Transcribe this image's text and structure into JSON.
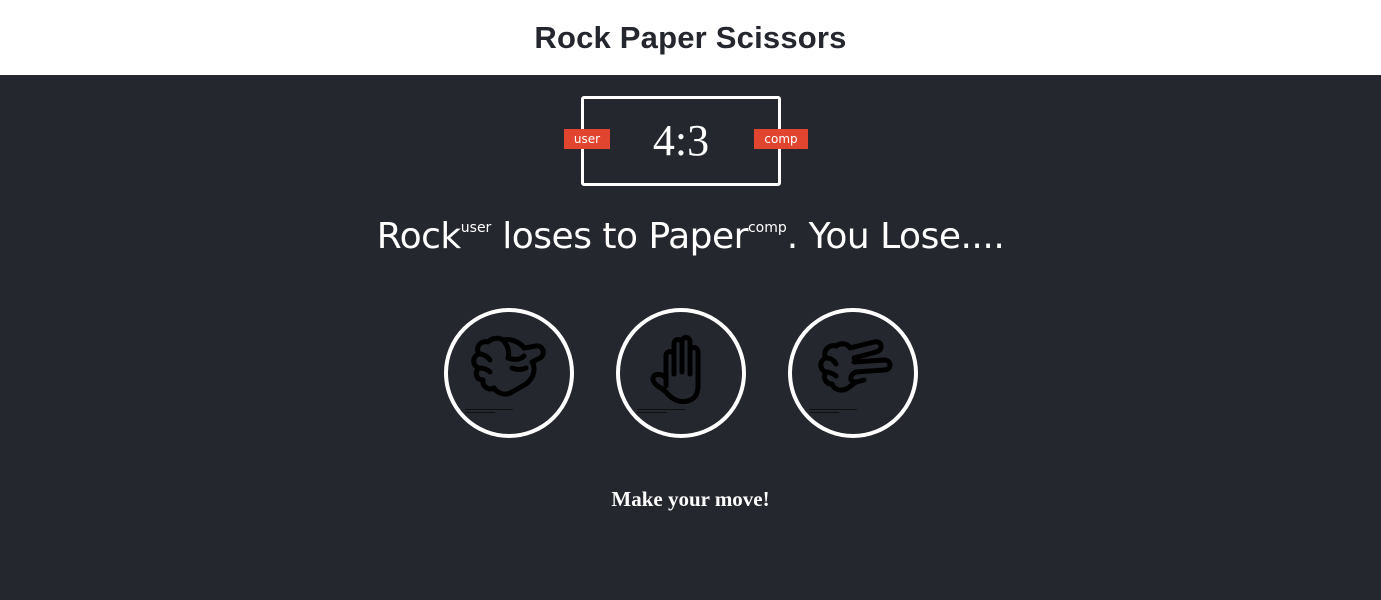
{
  "header": {
    "title": "Rock Paper Scissors"
  },
  "scoreboard": {
    "score": "4:3",
    "user_label": "user",
    "comp_label": "comp"
  },
  "result": {
    "user_choice": "Rock",
    "user_tag": "user",
    "verb": " loses to ",
    "comp_choice": "Paper",
    "comp_tag": "comp",
    "message": ". You Lose...."
  },
  "choices": [
    {
      "icon": "rock-fist-icon"
    },
    {
      "icon": "paper-hand-icon"
    },
    {
      "icon": "scissors-hand-icon"
    }
  ],
  "action_message": "Make your move!",
  "colors": {
    "background": "#24272e",
    "header_bg": "#ffffff",
    "badge": "#e2452f",
    "text": "#ffffff"
  }
}
